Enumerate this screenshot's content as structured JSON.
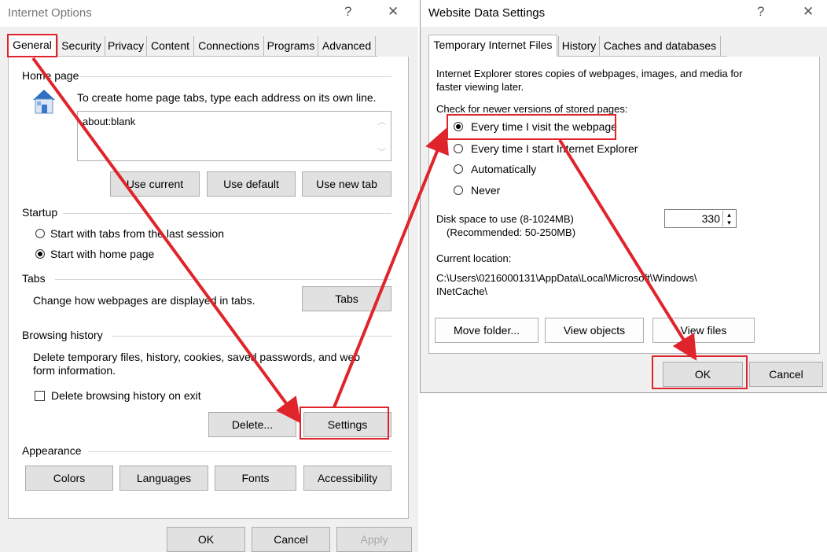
{
  "internet_options": {
    "title": "Internet Options",
    "help": "?",
    "close": "✕",
    "tabs": [
      "General",
      "Security",
      "Privacy",
      "Content",
      "Connections",
      "Programs",
      "Advanced"
    ],
    "home_page": {
      "label": "Home page",
      "instruction": "To create home page tabs, type each address on its own line.",
      "value": "about:blank",
      "buttons": [
        "Use current",
        "Use default",
        "Use new tab"
      ]
    },
    "startup": {
      "label": "Startup",
      "options": [
        "Start with tabs from the last session",
        "Start with home page"
      ],
      "selected_index": 1
    },
    "tabs_group": {
      "label": "Tabs",
      "text": "Change how webpages are displayed in tabs.",
      "button": "Tabs"
    },
    "browsing_history": {
      "label": "Browsing history",
      "text_line1": "Delete temporary files, history, cookies, saved passwords, and web",
      "text_line2": "form information.",
      "checkbox_label": "Delete browsing history on exit",
      "checkbox_checked": false,
      "delete_button": "Delete...",
      "settings_button": "Settings"
    },
    "appearance": {
      "label": "Appearance",
      "buttons": [
        "Colors",
        "Languages",
        "Fonts",
        "Accessibility"
      ]
    },
    "footer": {
      "ok": "OK",
      "cancel": "Cancel",
      "apply": "Apply"
    }
  },
  "website_data": {
    "title": "Website Data Settings",
    "help": "?",
    "close": "✕",
    "tabs": [
      "Temporary Internet Files",
      "History",
      "Caches and databases"
    ],
    "description_line1": "Internet Explorer stores copies of webpages, images, and media for",
    "description_line2": "faster viewing later.",
    "check_label": "Check for newer versions of stored pages:",
    "options": [
      "Every time I visit the webpage",
      "Every time I start Internet Explorer",
      "Automatically",
      "Never"
    ],
    "selected_index": 0,
    "disk_label": "Disk space to use (8-1024MB)",
    "disk_recommended": "(Recommended: 50-250MB)",
    "disk_value": "330",
    "current_location_label": "Current location:",
    "current_location_line1": "C:\\Users\\0216000131\\AppData\\Local\\Microsoft\\Windows\\",
    "current_location_line2": "INetCache\\",
    "buttons": [
      "Move folder...",
      "View objects",
      "View files"
    ],
    "footer": {
      "ok": "OK",
      "cancel": "Cancel"
    }
  },
  "colors": {
    "annotation_red": "#e0242b"
  }
}
